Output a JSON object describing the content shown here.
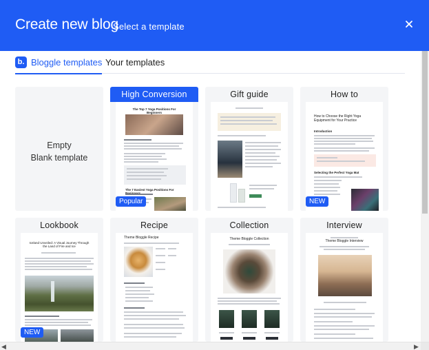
{
  "header": {
    "title": "Create new blog",
    "subtitle": "Select a template"
  },
  "tabs": [
    {
      "label": "Bloggle templates",
      "active": true,
      "logo": "b."
    },
    {
      "label": "Your templates",
      "active": false
    }
  ],
  "templates": {
    "empty": {
      "line1": "Empty",
      "line2": "Blank template"
    },
    "high_conversion": {
      "label": "High Conversion",
      "badge": "Popular",
      "heading": "The Top 7 Yoga Positions For Beginners",
      "subheading": "The 7 Easiest Yoga Positions For Beginners"
    },
    "gift_guide": {
      "label": "Gift guide"
    },
    "how_to": {
      "label": "How to",
      "badge": "NEW",
      "heading": "How to Choose the Right Yoga Equipment for Your Practice",
      "section": "Introduction",
      "section2": "Selecting the Perfect Yoga Mat"
    },
    "lookbook": {
      "label": "Lookbook",
      "badge": "NEW",
      "heading": "Iceland Unveiled: A Visual Journey Through the Land of Fire and Ice"
    },
    "recipe": {
      "label": "Recipe",
      "heading": "Theme Bloggle Recipe"
    },
    "collection": {
      "label": "Collection",
      "heading": "Theme Bloggle Collection"
    },
    "interview": {
      "label": "Interview",
      "heading": "Theme Bloggle Interview"
    }
  },
  "colors": {
    "accent": "#1f5cf4",
    "card_bg": "#f4f5f7"
  },
  "icons": {
    "close": "close-icon",
    "scroll_left": "chevron-left-icon",
    "scroll_right": "chevron-right-icon"
  }
}
